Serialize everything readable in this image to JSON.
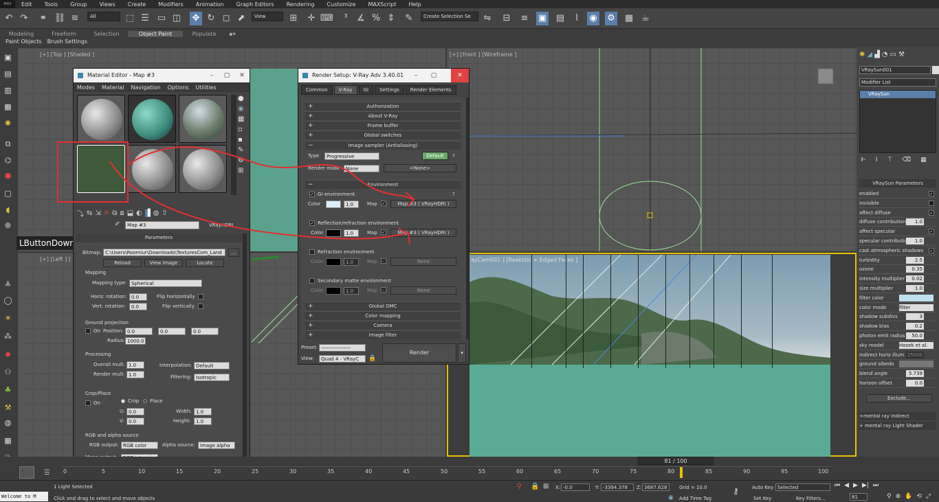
{
  "app": {
    "icon_label": "MAX"
  },
  "menu": [
    "Edit",
    "Tools",
    "Group",
    "Views",
    "Create",
    "Modifiers",
    "Animation",
    "Graph Editors",
    "Rendering",
    "Customize",
    "MAXScript",
    "Help"
  ],
  "toolbar": {
    "filter_dropdown": "All",
    "ref_coord": "View",
    "selection_set": "Create Selection Se"
  },
  "ribbon": {
    "tabs": [
      "Modeling",
      "Freeform",
      "Selection",
      "Object Paint",
      "Populate"
    ],
    "active": "Object Paint",
    "sub": [
      "Paint Objects",
      "Brush Settings"
    ]
  },
  "viewports": {
    "top": "[+] [Top ] [Shaded ]",
    "front": "[+] [Front ] [Wireframe ]",
    "left": "[+] [Left ] [ ]",
    "persp": "ayCam001 ] [Realistic + Edged Faces ]"
  },
  "tooltip": "LButtonDown",
  "material_editor": {
    "title": "Material Editor - Map #3",
    "menu": [
      "Modes",
      "Material",
      "Navigation",
      "Options",
      "Utilities"
    ],
    "map_name": "Map #3",
    "map_type": "VRayHDRI",
    "params_header": "Parameters",
    "bitmap_label": "Bitmap:",
    "bitmap_path": "C:\\Users\\Roomiur\\Downloads\\TexturesCom_Land",
    "reload": "Reload",
    "view_image": "View image",
    "locate": "Locate",
    "mapping_group": "Mapping",
    "mapping_type_label": "Mapping type:",
    "mapping_type": "Spherical",
    "horiz_rot_label": "Horiz. rotation:",
    "horiz_rot": "0.0",
    "flip_h": "Flip horizontally",
    "vert_rot_label": "Vert. rotation:",
    "vert_rot": "0.0",
    "flip_v": "Flip vertically",
    "ground_group": "Ground projection",
    "on": "On",
    "position_label": "Position:",
    "pos_x": "0.0",
    "pos_y": "0.0",
    "pos_z": "0.0",
    "radius_label": "Radius:",
    "radius": "1000.0",
    "processing_group": "Processing",
    "overall_mult_label": "Overall mult:",
    "overall_mult": "1.0",
    "render_mult_label": "Render mult:",
    "render_mult": "1.0",
    "interp_label": "Interpolation:",
    "interp": "Default",
    "filtering_label": "Filtering:",
    "filtering": "Isotropic",
    "crop_group": "Crop/Place",
    "crop": "Crop",
    "place": "Place",
    "u_label": "U:",
    "u": "0.0",
    "v_label": "V:",
    "v": "0.0",
    "width_label": "Width:",
    "width": "1.0",
    "height_label": "Height:",
    "height": "1.0",
    "rgb_group": "RGB and alpha source",
    "rgb_output_label": "RGB output:",
    "rgb_output": "RGB color",
    "alpha_source_label": "Alpha source:",
    "alpha_source": "Image alpha",
    "mono_output_label": "Mono output:",
    "mono_output": "RGB intensi"
  },
  "render_setup": {
    "title": "Render Setup: V-Ray Adv 3.40.01",
    "tabs": [
      "Common",
      "V-Ray",
      "GI",
      "Settings",
      "Render Elements"
    ],
    "active_tab": "V-Ray",
    "rollouts_top": [
      "Authorization",
      "About V-Ray",
      "Frame buffer",
      "Global switches"
    ],
    "image_sampler": "Image sampler (Antialiasing)",
    "type_label": "Type",
    "type": "Progressive",
    "default_btn": "Default",
    "help": "?",
    "render_mask_label": "Render mask",
    "render_mask": "None",
    "render_mask_value": "<None>",
    "environment": "Environment",
    "gi_env": "GI environment",
    "gi_color_label": "Color",
    "gi_mult": "1.0",
    "map_label": "Map",
    "gi_map": "Map #3 ( VRayHDRI )",
    "refl_env": "Reflection/refraction environment",
    "refl_mult": "1.0",
    "refl_map": "Map #3 ( VRayHDRI )",
    "refr_env": "Refraction environment",
    "refr_mult": "1.0",
    "refr_map": "None",
    "sec_env": "Secondary matte environment",
    "sec_mult": "1.0",
    "sec_map": "None",
    "rollouts_bottom": [
      "Global DMC",
      "Color mapping",
      "Camera",
      "Image filter"
    ],
    "preset_label": "Preset:",
    "preset": "-----------------",
    "view_label": "View:",
    "view": "Quad 4 - VRayC",
    "render_btn": "Render"
  },
  "command_panel": {
    "object_name": "VRaySun001",
    "modifier_list": "Modifier List",
    "stack_item": "VRaySun",
    "rollout_title": "VRaySun Parameters",
    "rows": [
      {
        "label": "enabled",
        "check": true
      },
      {
        "label": "invisible",
        "check": false
      },
      {
        "label": "affect diffuse",
        "check": true
      },
      {
        "label": "diffuse contribution",
        "value": "1.0"
      },
      {
        "label": "affect specular",
        "check": true
      },
      {
        "label": "specular contributio",
        "value": "1.0"
      },
      {
        "label": "cast atmospheric shadows",
        "check": true
      },
      {
        "label": "turbidity",
        "value": "2.5"
      },
      {
        "label": "ozone",
        "value": "0.35"
      },
      {
        "label": "intensity multiplier",
        "value": "0.02"
      },
      {
        "label": "size multiplier",
        "value": "1.0"
      },
      {
        "label": "filter color",
        "value": ""
      },
      {
        "label": "color mode",
        "value": "filter"
      },
      {
        "label": "shadow subdivs",
        "value": "3"
      },
      {
        "label": "shadow bias",
        "value": "0.2"
      },
      {
        "label": "photon emit radius",
        "value": "50.0"
      },
      {
        "label": "sky model",
        "value": "Hosek et al."
      },
      {
        "label": "indirect horiz illum",
        "value": "25000"
      },
      {
        "label": "ground albedo",
        "value": ""
      },
      {
        "label": "blend angle",
        "value": "5.739"
      },
      {
        "label": "horizon offset",
        "value": "0.0"
      }
    ],
    "exclude": "Exclude...",
    "extra_rollouts": [
      "mental ray Indirect Illumination",
      "mental ray Light Shader"
    ]
  },
  "timeline": {
    "frame": "81 / 100",
    "ticks": [
      "0",
      "5",
      "10",
      "15",
      "20",
      "25",
      "30",
      "35",
      "40",
      "45",
      "50",
      "55",
      "60",
      "65",
      "70",
      "75",
      "80",
      "85",
      "90",
      "95",
      "100"
    ]
  },
  "status": {
    "listener": "Welcome to M",
    "selected": "1 Light Selected",
    "prompt": "Click and drag to select and move objects",
    "x_label": "X:",
    "x": "-0.0",
    "y_label": "Y:",
    "y": "-3394.378",
    "z_label": "Z:",
    "z": "3687.628",
    "grid": "Grid = 10.0",
    "add_time_tag": "Add Time Tag",
    "auto_key": "Auto Key",
    "selected_dd": "Selected",
    "set_key": "Set Key",
    "key_filters": "Key Filters...",
    "frame": "81"
  },
  "colors": {
    "annotation": "#e23030",
    "viewport_active": "#e8c200",
    "accent_blue": "#5a7fa8",
    "ground_green": "#5aab95"
  }
}
